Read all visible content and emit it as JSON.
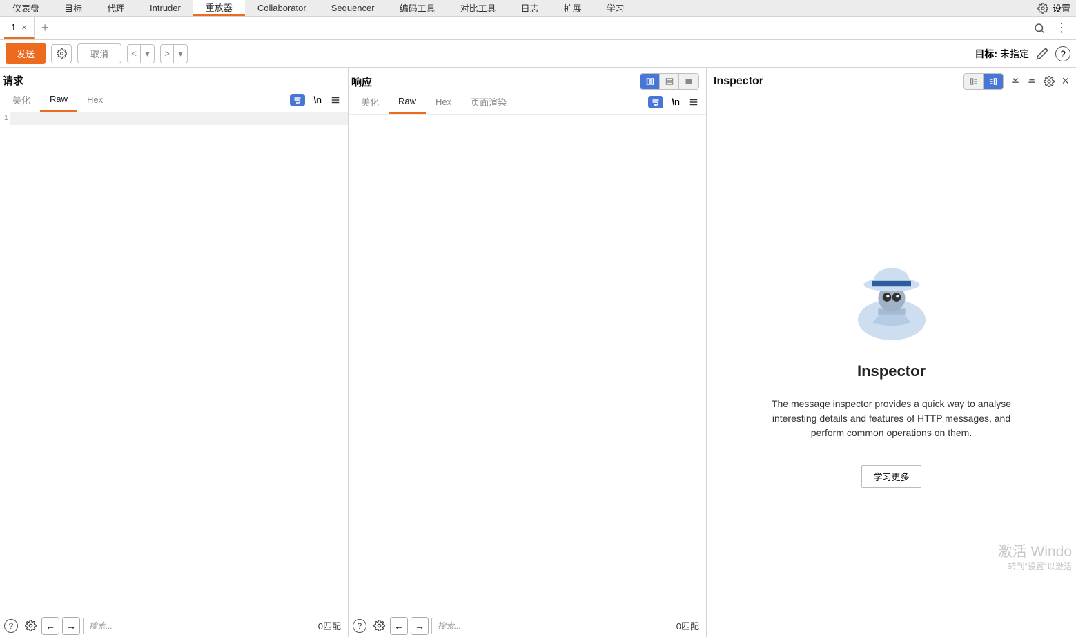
{
  "icons": {
    "nl": "\\n"
  },
  "main_tabs": {
    "items": [
      "仪表盘",
      "目标",
      "代理",
      "Intruder",
      "重放器",
      "Collaborator",
      "Sequencer",
      "编码工具",
      "对比工具",
      "日志",
      "扩展",
      "学习"
    ],
    "active_index": 4,
    "settings_label": "设置"
  },
  "sub_tabs": {
    "items": [
      {
        "label": "1"
      }
    ]
  },
  "action_bar": {
    "send": "发送",
    "cancel": "取消",
    "target_prefix": "目标: ",
    "target_value": "未指定"
  },
  "request": {
    "title": "请求",
    "tabs": [
      "美化",
      "Raw",
      "Hex"
    ],
    "active_tab": 1,
    "line_no": "1",
    "search_placeholder": "搜索...",
    "match_text": "0匹配"
  },
  "response": {
    "title": "响应",
    "tabs": [
      "美化",
      "Raw",
      "Hex",
      "页面渲染"
    ],
    "active_tab": 1,
    "search_placeholder": "搜索...",
    "match_text": "0匹配"
  },
  "inspector": {
    "header_title": "Inspector",
    "heading": "Inspector",
    "description": "The message inspector provides a quick way to analyse interesting details and features of HTTP messages, and perform common operations on them.",
    "learn_more": "学习更多"
  },
  "watermark": {
    "title": "激活 Windo",
    "subtitle": "转到\"设置\"以激活"
  }
}
